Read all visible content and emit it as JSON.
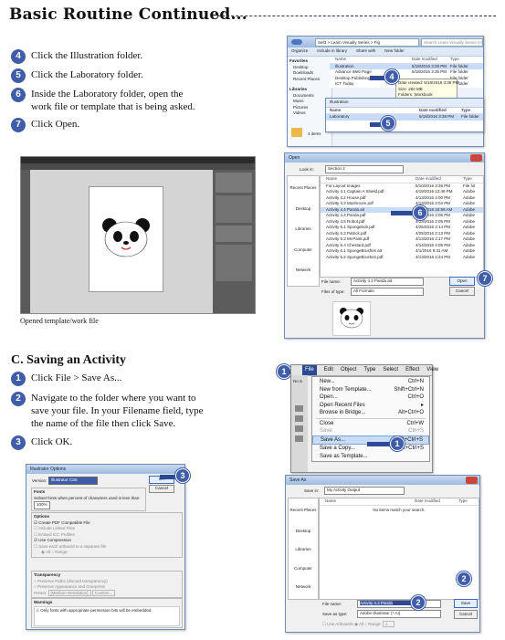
{
  "header": {
    "title": "Basic Routine Continued..."
  },
  "steps_top": [
    {
      "num": "4",
      "text": "Click the Illustration folder."
    },
    {
      "num": "5",
      "text": "Click the Laboratory folder."
    },
    {
      "num": "6",
      "text": "Inside the Laboratory folder, open the work file or template that is being asked."
    },
    {
      "num": "7",
      "text": "Click Open."
    }
  ],
  "caption": "Opened template/work file",
  "section_c": {
    "title": "C. Saving an Activity"
  },
  "steps_c": [
    {
      "num": "1",
      "text": "Click File > Save As..."
    },
    {
      "num": "2",
      "text": "Navigate to the folder where you want to save your file. In your Filename field, type the name of the file then click Save."
    },
    {
      "num": "3",
      "text": "Click OK."
    }
  ],
  "explorer": {
    "address": "Set3 > Learn Visually Series > Fig",
    "search": "Search Learn Visually Series (High Sch...)",
    "toolbar": [
      "Organize",
      "Include in library",
      "Share with",
      "New folder"
    ],
    "nav": [
      "Favorites",
      "Desktop",
      "Downloads",
      "Recent Places",
      "Libraries",
      "Documents",
      "Music",
      "Pictures",
      "Videos"
    ],
    "columns": [
      "Name",
      "Date modified",
      "Type"
    ],
    "rows": [
      {
        "name": "Illustration",
        "date": "5/18/2016 3:38 PM",
        "type": "File folder"
      },
      {
        "name": "Advance Web Page",
        "date": "5/18/2016 3:35 PM",
        "type": "File folder"
      },
      {
        "name": "Desktop Publishing",
        "date": "",
        "type": "File folder"
      },
      {
        "name": "ICT Today",
        "date": "",
        "type": "File folder"
      }
    ],
    "tooltip": [
      "Date created: 5/18/2016 3:35 PM",
      "Size: 284 MB",
      "Folders: Workbook"
    ],
    "status": "4 items",
    "sub": {
      "path": "Illustration",
      "columns": [
        "Name",
        "Date modified",
        "Type"
      ],
      "row": {
        "name": "Laboratory",
        "date": "5/18/2016 3:38 PM",
        "type": "File folder"
      }
    },
    "callout_a": "4",
    "callout_b": "5"
  },
  "open_dialog": {
    "title": "Open",
    "look_in_label": "Look in:",
    "look_in": "Section 2",
    "places": [
      "Recent Places",
      "Desktop",
      "Libraries",
      "Computer",
      "Network"
    ],
    "columns": [
      "Name",
      "Date modified",
      "Type"
    ],
    "files": [
      {
        "name": "For Layout Images",
        "date": "5/10/2016 3:36 PM",
        "type": "File fol"
      },
      {
        "name": "Activity 4.1 Captain A Shield.pdf",
        "date": "4/19/2016 12:49 PM",
        "type": "Adobe"
      },
      {
        "name": "Activity 4.2 House.pdf",
        "date": "4/13/2016 4:00 PM",
        "type": "Adobe"
      },
      {
        "name": "Activity 4.3 Mushroom.pdf",
        "date": "4/13/2016 2:04 PM",
        "type": "Adobe"
      },
      {
        "name": "Activity 4.4 Panda.ait",
        "date": "3/28/2016 10:59 AM",
        "type": "Adobe"
      },
      {
        "name": "Activity 4.4 Panda.pdf",
        "date": "4/13/2016 2:05 PM",
        "type": "Adobe"
      },
      {
        "name": "Activity 4.5 Robot.pdf",
        "date": "4/13/2016 2:05 PM",
        "type": "Adobe"
      },
      {
        "name": "Activity 5.1 Spongebob.pdf",
        "date": "4/25/2016 2:14 PM",
        "type": "Adobe"
      },
      {
        "name": "Activity 5.2 Patrick.pdf",
        "date": "4/25/2016 2:13 PM",
        "type": "Adobe"
      },
      {
        "name": "Activity 5.3 Mr.Paint.pdf",
        "date": "4/13/2016 2:17 PM",
        "type": "Adobe"
      },
      {
        "name": "Activity 5.4 Chestard.pdf",
        "date": "4/14/2016 4:05 PM",
        "type": "Adobe"
      },
      {
        "name": "Activity 6.1 SpongeBrushes.ait",
        "date": "4/1/2016 9:31 AM",
        "type": "Adobe"
      },
      {
        "name": "Activity 6.2 SpongeBrushes.pdf",
        "date": "4/13/2016 2:24 PM",
        "type": "Adobe"
      }
    ],
    "filename_label": "File name:",
    "filename": "Activity 4.4 Panda.ait",
    "filetype_label": "Files of type:",
    "filetype": "All Formats",
    "open_label": "Open",
    "cancel_label": "Cancel",
    "callout_a": "6",
    "callout_b": "7"
  },
  "file_menu": {
    "menubar": [
      "File",
      "Edit",
      "Object",
      "Type",
      "Select",
      "Effect",
      "View"
    ],
    "side_label": "No S",
    "items": [
      {
        "label": "New...",
        "shortcut": "Ctrl+N",
        "disabled": false
      },
      {
        "label": "New from Template...",
        "shortcut": "Shift+Ctrl+N",
        "disabled": false
      },
      {
        "label": "Open...",
        "shortcut": "Ctrl+O",
        "disabled": false
      },
      {
        "label": "Open Recent Files",
        "shortcut": "▸",
        "disabled": false
      },
      {
        "label": "Browse in Bridge...",
        "shortcut": "Alt+Ctrl+O",
        "disabled": false
      },
      {
        "label": "Close",
        "shortcut": "Ctrl+W",
        "disabled": false
      },
      {
        "label": "Save",
        "shortcut": "Ctrl+S",
        "disabled": true
      },
      {
        "label": "Save As...",
        "shortcut": "Shift+Ctrl+S",
        "disabled": false
      },
      {
        "label": "Save a Copy...",
        "shortcut": "Alt+Ctrl+S",
        "disabled": false
      },
      {
        "label": "Save as Template...",
        "shortcut": "",
        "disabled": false
      }
    ],
    "callout_a": "1"
  },
  "ai_options": {
    "title": "Illustrator Options",
    "version_label": "Version:",
    "version": "Illustrator CS5",
    "ok_label": "OK",
    "cancel_label": "Cancel",
    "fonts_head": "Fonts",
    "fonts_text": "Subset fonts when percent of characters used is less than:",
    "fonts_value": "100%",
    "options_head": "Options",
    "options": [
      {
        "label": "Create PDF Compatible File",
        "checked": true
      },
      {
        "label": "Include Linked Files",
        "checked": false
      },
      {
        "label": "Embed ICC Profiles",
        "checked": false
      },
      {
        "label": "Use Compression",
        "checked": true
      },
      {
        "label": "Save each artboard to a separate file",
        "checked": false
      }
    ],
    "artboards": [
      "All",
      "Range:"
    ],
    "transparency_head": "Transparency",
    "transparency": [
      "Preserve Paths (discard transparency)",
      "Preserve Appearance and Overprints"
    ],
    "preset_label": "Preset:",
    "preset": "[Medium Resolution]",
    "custom_label": "Custom...",
    "warnings_head": "Warnings",
    "warning": "Only fonts with appropriate permission bits will be embedded.",
    "callout": "3"
  },
  "save_dialog": {
    "title": "Save As",
    "save_in_label": "Save in:",
    "save_in": "My Activity Output",
    "columns": [
      "Name",
      "Date modified",
      "Type"
    ],
    "empty": "No items match your search.",
    "places": [
      "Recent Places",
      "Desktop",
      "Libraries",
      "Computer",
      "Network"
    ],
    "filename_label": "File name:",
    "filename": "Activity 4.4 Panda",
    "savetype_label": "Save as type:",
    "savetype": "Adobe Illustrator (*.AI)",
    "save_label": "Save",
    "cancel_label": "Cancel",
    "artboards_label": "Use Artboards",
    "artboards_opts": [
      "All",
      "Range:"
    ],
    "range_value": "1",
    "callout": "2"
  }
}
